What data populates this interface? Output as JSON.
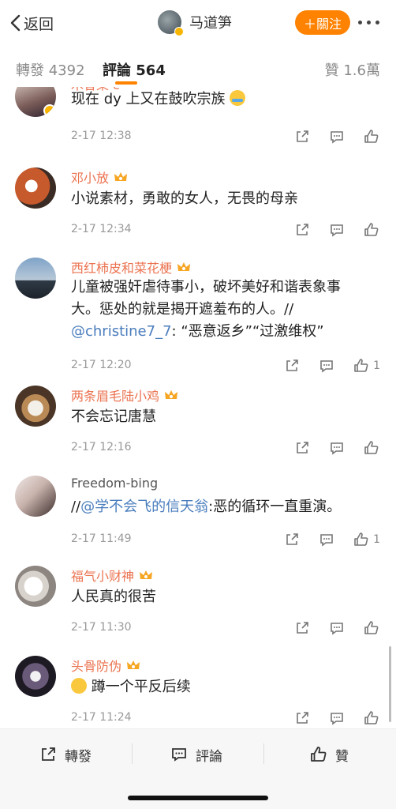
{
  "header": {
    "back_label": "返回",
    "account_name": "马道笋",
    "follow_label": "＋關注"
  },
  "tabs": {
    "repost_label": "轉發",
    "repost_count": "4392",
    "comments_label": "評論",
    "comments_count": "564",
    "likes_label": "贊",
    "likes_count": "1.6萬"
  },
  "comments": [
    {
      "username": "木香菜 ε",
      "text": "现在 dy 上又在鼓吹宗族",
      "emoji": "crying-laugh-emoji",
      "time": "2-17 12:38",
      "likes": ""
    },
    {
      "username": "邓小放",
      "text": "小说素材，勇敢的女人，无畏的母亲",
      "time": "2-17 12:34",
      "likes": ""
    },
    {
      "username": "西红柿皮和菜花梗",
      "text_line1": "儿童被强奸虐待事小，破坏美好和谐表象事",
      "text_line2": "大。惩处的就是揭开遮羞布的人。//",
      "mention": "@christine7_7",
      "text_line3_rest": ": “恶意返乡”“过激维权”",
      "time": "2-17 12:20",
      "likes": "1"
    },
    {
      "username": "两条眉毛陆小鸡",
      "text": "不会忘记唐慧",
      "time": "2-17 12:16",
      "likes": ""
    },
    {
      "username": "Freedom-bing",
      "prefix": "//",
      "mention": "@学不会飞的信天翁",
      "text_rest": ":恶的循环一直重演。",
      "time": "2-17 11:49",
      "likes": "1"
    },
    {
      "username": "福气小财神",
      "text": "人民真的很苦",
      "time": "2-17 11:30",
      "likes": ""
    },
    {
      "username": "头骨防伪",
      "emoji": "smile-emoji",
      "text": "蹲一个平反后续",
      "time": "2-17 11:24",
      "likes": ""
    }
  ],
  "bottom_bar": {
    "repost_label": "轉發",
    "comment_label": "評論",
    "like_label": "贊"
  },
  "colors": {
    "accent": "#ff8200",
    "username": "#eb7350",
    "link": "#4a7dbd",
    "verified_badge": "#f7b500"
  }
}
